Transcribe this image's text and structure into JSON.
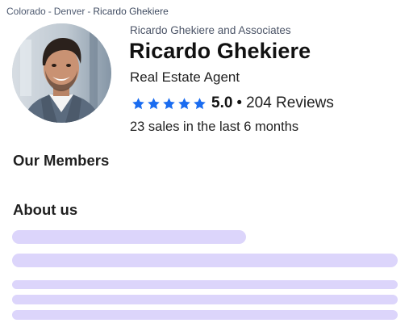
{
  "breadcrumb": {
    "items": [
      {
        "label": "Colorado"
      },
      {
        "label": "Denver"
      },
      {
        "label": "Ricardo Ghekiere"
      }
    ],
    "separator": "-"
  },
  "agent": {
    "company": "Ricardo Ghekiere and Associates",
    "name": "Ricardo Ghekiere",
    "title": "Real Estate Agent",
    "rating": "5.0",
    "rating_stars": 5,
    "reviews": "204 Reviews",
    "rating_separator": "•",
    "sales": "23 sales in the last 6 months"
  },
  "sections": {
    "members_heading": "Our Members",
    "about_heading": "About us"
  },
  "colors": {
    "star": "#1a6cf0",
    "skeleton": "#dcd5fb"
  },
  "icons": {
    "star": "star-icon"
  }
}
